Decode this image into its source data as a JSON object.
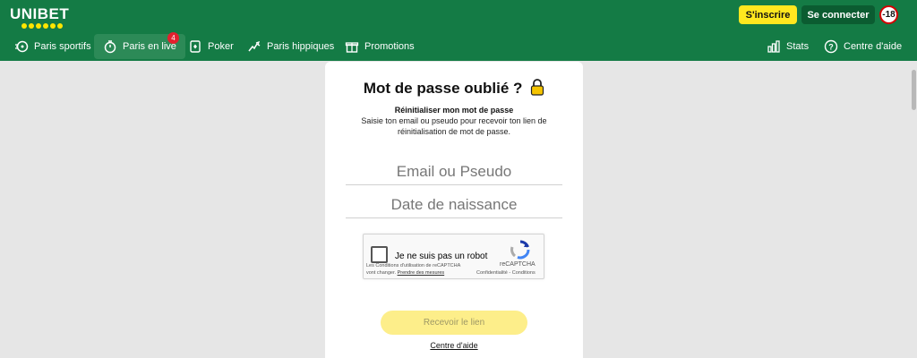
{
  "header": {
    "brand": "UNIBET",
    "signup_label": "S'inscrire",
    "login_label": "Se connecter",
    "age_badge": "-18",
    "colors": {
      "primary": "#147b45",
      "accent": "#ffe71f"
    }
  },
  "nav": {
    "items": [
      {
        "label": "Paris sportifs",
        "icon": "sports-betting-icon"
      },
      {
        "label": "Paris en live",
        "icon": "stopwatch-icon",
        "badge": "4"
      },
      {
        "label": "Poker",
        "icon": "playing-card-icon"
      },
      {
        "label": "Paris hippiques",
        "icon": "horse-racing-icon"
      },
      {
        "label": "Promotions",
        "icon": "gift-icon"
      }
    ],
    "right": [
      {
        "label": "Stats",
        "icon": "bar-chart-icon"
      },
      {
        "label": "Centre d'aide",
        "icon": "help-circle-icon"
      }
    ]
  },
  "form": {
    "title": "Mot de passe oublié ?",
    "title_icon": "lock-icon",
    "subtitle": "Réinitialiser mon mot de passe",
    "description": "Saisie ton email ou pseudo pour recevoir ton lien de réinitialisation de mot de passe.",
    "email_placeholder": "Email ou Pseudo",
    "birthdate_placeholder": "Date de naissance",
    "submit_label": "Recevoir le lien",
    "help_link": "Centre d'aide"
  },
  "recaptcha": {
    "label": "Je ne suis pas un robot",
    "brand": "reCAPTCHA",
    "links": "Confidentialité - Conditions",
    "terms_text": "Les Conditions d'utilisation de reCAPTCHA vont changer.",
    "terms_link": "Prendre des mesures"
  }
}
